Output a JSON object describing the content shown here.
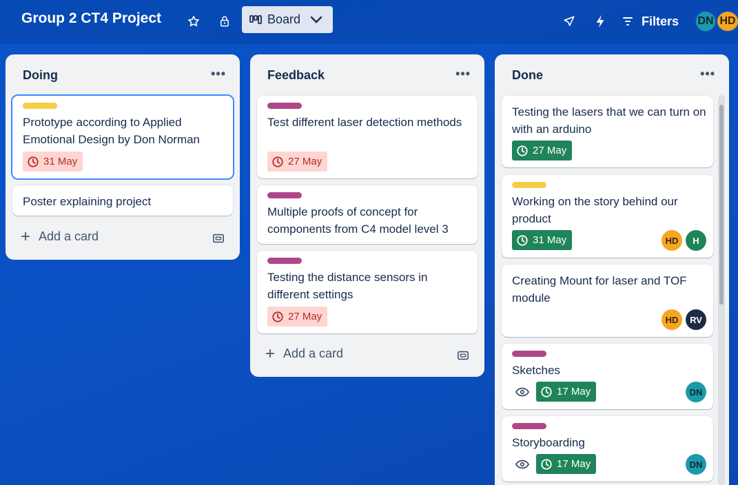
{
  "board": {
    "title": "Group 2 CT4 Project",
    "view_label": "Board",
    "filters_label": "Filters"
  },
  "members": [
    {
      "initials": "DN",
      "color": "#1d9aaa"
    },
    {
      "initials": "HD",
      "color": "#f5a623"
    }
  ],
  "colors": {
    "yellow_label": "#f5cd47",
    "purple_label": "#ae4787",
    "overdue_bg": "#ffd5d2",
    "done_bg": "#1f845a"
  },
  "lists": [
    {
      "title": "Doing",
      "add_card_label": "Add a card",
      "cards": [
        {
          "label_color": "yellow",
          "title": "Prototype according to Applied Emotional Design by Don Norman",
          "due": "31 May",
          "due_state": "overdue"
        },
        {
          "title": "Poster explaining project"
        }
      ]
    },
    {
      "title": "Feedback",
      "add_card_label": "Add a card",
      "cards": [
        {
          "label_color": "purple",
          "title": "Test different laser detection methods",
          "due": "27 May",
          "due_state": "overdue"
        },
        {
          "label_color": "purple",
          "title": "Multiple proofs of concept for components from C4 model level 3"
        },
        {
          "label_color": "purple",
          "title": "Testing the distance sensors in different settings",
          "due": "27 May",
          "due_state": "overdue"
        }
      ]
    },
    {
      "title": "Done",
      "cards": [
        {
          "title": "Testing the lasers that we can turn on with an arduino",
          "due": "27 May",
          "due_state": "complete"
        },
        {
          "label_color": "yellow",
          "title": "Working on the story behind our product",
          "due": "31 May",
          "due_state": "complete",
          "members": [
            "HD",
            "H"
          ]
        },
        {
          "title": "Creating Mount for laser and TOF module",
          "members": [
            "HD",
            "RV"
          ]
        },
        {
          "label_color": "purple",
          "title": "Sketches",
          "due": "17 May",
          "due_state": "complete",
          "watching": true,
          "members": [
            "DN"
          ]
        },
        {
          "label_color": "purple",
          "title": "Storyboarding",
          "due": "17 May",
          "due_state": "complete",
          "watching": true,
          "members": [
            "DN"
          ]
        }
      ]
    }
  ]
}
